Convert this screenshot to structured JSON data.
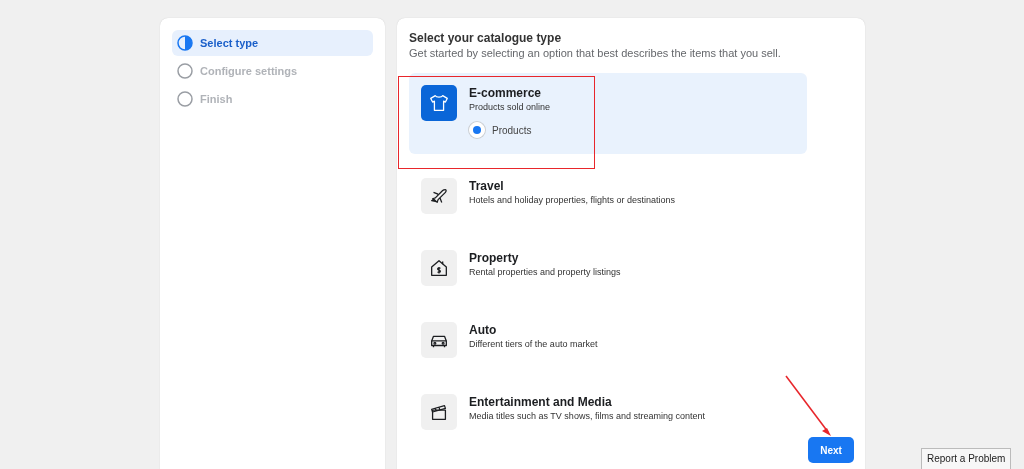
{
  "steps": [
    {
      "label": "Select type",
      "selected": true
    },
    {
      "label": "Configure settings",
      "selected": false
    },
    {
      "label": "Finish",
      "selected": false
    }
  ],
  "heading": "Select your catalogue type",
  "subheading": "Get started by selecting an option that best describes the items that you sell.",
  "options": [
    {
      "kind": "shirt",
      "title": "E-commerce",
      "description": "Products sold online",
      "selected": true,
      "choice": {
        "label": "Products",
        "selected": true
      }
    },
    {
      "kind": "plane",
      "title": "Travel",
      "description": "Hotels and holiday properties, flights or destinations",
      "selected": false
    },
    {
      "kind": "house",
      "title": "Property",
      "description": "Rental properties and property listings",
      "selected": false
    },
    {
      "kind": "car",
      "title": "Auto",
      "description": "Different tiers of the auto market",
      "selected": false
    },
    {
      "kind": "clapper",
      "title": "Entertainment and Media",
      "description": "Media titles such as TV shows, films and streaming content",
      "selected": false
    }
  ],
  "next_button": "Next",
  "report_button": "Report a Problem"
}
